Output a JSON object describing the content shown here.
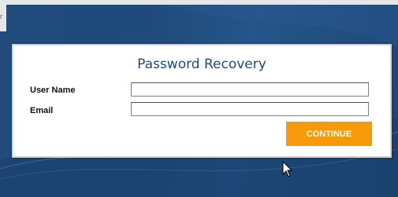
{
  "window": {
    "edge_glyph": "r"
  },
  "dialog": {
    "title": "Password Recovery",
    "fields": [
      {
        "label": "User Name",
        "value": "",
        "placeholder": ""
      },
      {
        "label": "Email",
        "value": "",
        "placeholder": ""
      }
    ],
    "continue_label": "CONTINUE"
  },
  "colors": {
    "background": "#214b7c",
    "title": "#1f4a7f",
    "button": "#f79a0a",
    "button_text": "#ffffff"
  },
  "icons": {
    "cursor": "mouse-pointer-icon"
  }
}
